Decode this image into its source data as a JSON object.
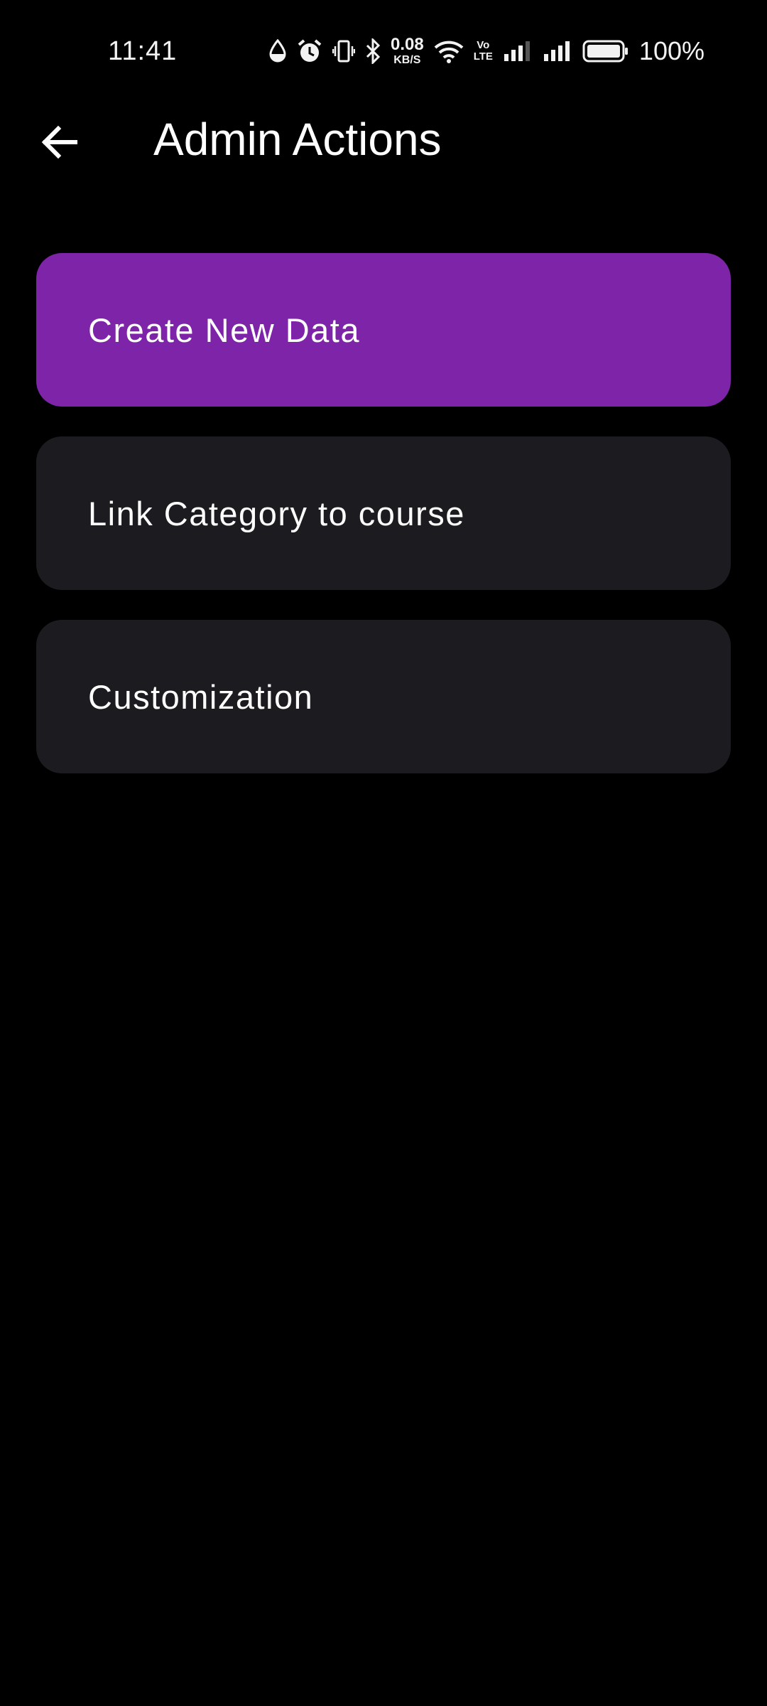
{
  "status_bar": {
    "time": "11:41",
    "net_speed_value": "0.08",
    "net_speed_unit": "KB/S",
    "volte_top": "Vo",
    "volte_bottom": "LTE",
    "battery_percent": "100%",
    "icons": [
      "data-saver-icon",
      "alarm-icon",
      "vibrate-icon",
      "bluetooth-icon",
      "wifi-icon",
      "signal-icon",
      "signal-icon",
      "battery-icon"
    ]
  },
  "app_bar": {
    "back_icon": "arrow-back-icon",
    "title": "Admin Actions"
  },
  "actions": [
    {
      "label": "Create New Data",
      "selected": true
    },
    {
      "label": "Link Category to course",
      "selected": false
    },
    {
      "label": "Customization",
      "selected": false
    }
  ],
  "colors": {
    "background": "#000000",
    "card": "#1c1b20",
    "card_selected": "#7e24a8",
    "text": "#ffffff"
  }
}
